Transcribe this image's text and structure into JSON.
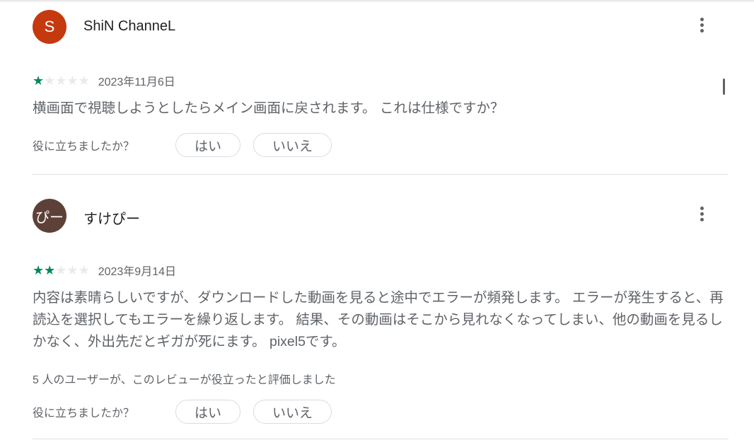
{
  "reviews": [
    {
      "author": "ShiN ChanneL",
      "avatar_text": "S",
      "avatar_color": "#c5390f",
      "rating": 1,
      "max_rating": 5,
      "date": "2023年11月6日",
      "text": "横画面で視聴しようとしたらメイン画面に戻されます。 これは仕様ですか？",
      "helpful_count_text": "",
      "feedback_question": "役に立ちましたか？",
      "yes_label": "はい",
      "no_label": "いいえ"
    },
    {
      "author": "すけぴー",
      "avatar_text": "ぴー",
      "avatar_color": "#5d4037",
      "rating": 2,
      "max_rating": 5,
      "date": "2023年9月14日",
      "text": "内容は素晴らしいですが、ダウンロードした動画を見ると途中でエラーが頻発します。 エラーが発生すると、再読込を選択してもエラーを繰り返します。 結果、その動画はそこから見れなくなってしまい、他の動画を見るしかなく、外出先だとギガが死にます。 pixel5です。",
      "helpful_count_text": "5 人のユーザーが、このレビューが役立ったと評価しました",
      "feedback_question": "役に立ちましたか？",
      "yes_label": "はい",
      "no_label": "いいえ"
    }
  ],
  "colors": {
    "star_filled": "#01875f",
    "star_empty": "#e8eaed",
    "secondary_text": "#5f6368"
  },
  "icons": {
    "star": "★",
    "more": "more-vert-icon"
  }
}
